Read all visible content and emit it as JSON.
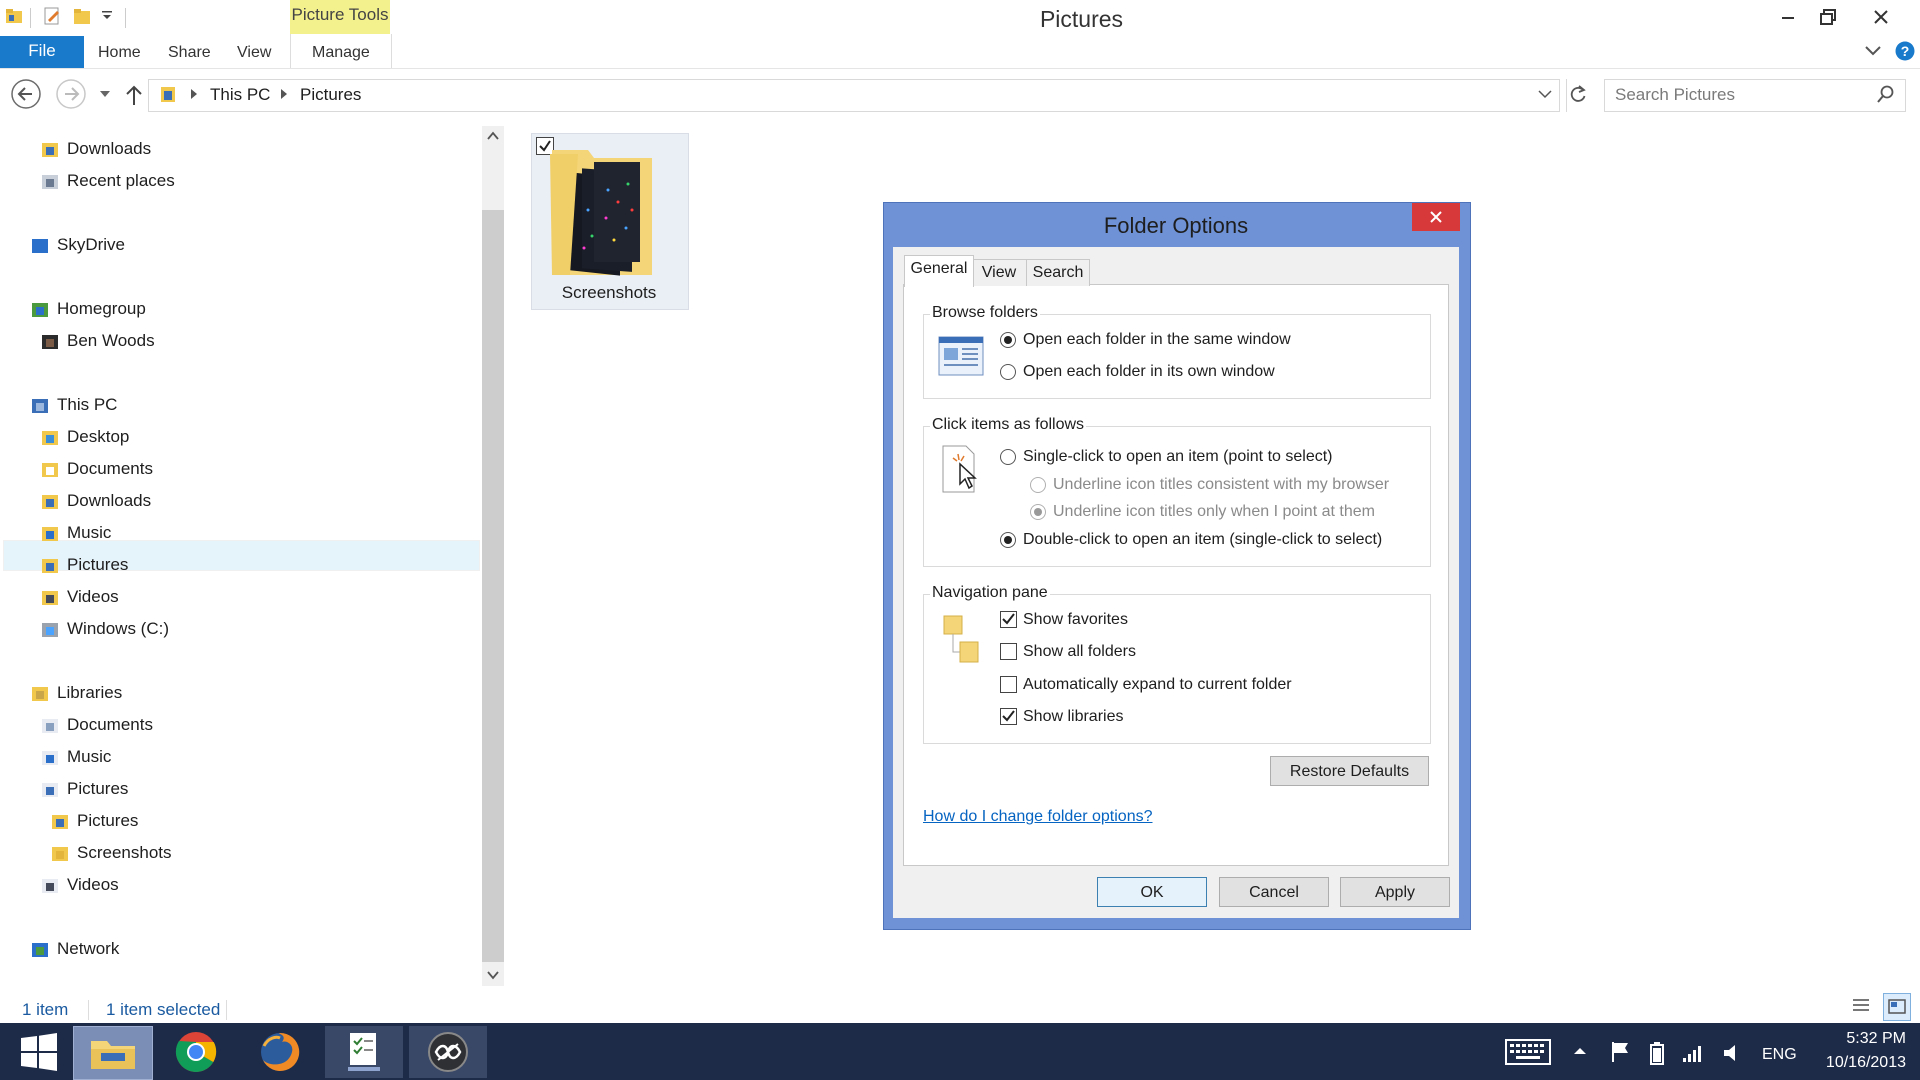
{
  "window": {
    "title": "Pictures",
    "context_tab": "Picture Tools"
  },
  "ribbon": {
    "file": "File",
    "tabs": [
      "Home",
      "Share",
      "View",
      "Manage"
    ]
  },
  "address": {
    "parts": [
      "This PC",
      "Pictures"
    ]
  },
  "search": {
    "placeholder": "Search Pictures"
  },
  "nav": {
    "items": [
      {
        "label": "Downloads",
        "icon": "downloads-folder-icon"
      },
      {
        "label": "Recent places",
        "icon": "recent-places-icon"
      },
      {
        "label": "SkyDrive",
        "icon": "skydrive-cloud-icon"
      },
      {
        "label": "Homegroup",
        "icon": "homegroup-icon"
      },
      {
        "label": "Ben Woods",
        "icon": "user-avatar-icon"
      },
      {
        "label": "This PC",
        "icon": "this-pc-icon"
      },
      {
        "label": "Desktop",
        "icon": "desktop-folder-icon"
      },
      {
        "label": "Documents",
        "icon": "documents-folder-icon"
      },
      {
        "label": "Downloads",
        "icon": "downloads-folder-icon"
      },
      {
        "label": "Music",
        "icon": "music-folder-icon"
      },
      {
        "label": "Pictures",
        "icon": "pictures-folder-icon"
      },
      {
        "label": "Videos",
        "icon": "videos-folder-icon"
      },
      {
        "label": "Windows (C:)",
        "icon": "drive-icon"
      },
      {
        "label": "Libraries",
        "icon": "libraries-icon"
      },
      {
        "label": "Documents",
        "icon": "documents-library-icon"
      },
      {
        "label": "Music",
        "icon": "music-library-icon"
      },
      {
        "label": "Pictures",
        "icon": "pictures-library-icon"
      },
      {
        "label": "Pictures",
        "icon": "pictures-folder-icon"
      },
      {
        "label": "Screenshots",
        "icon": "folder-icon"
      },
      {
        "label": "Videos",
        "icon": "videos-library-icon"
      },
      {
        "label": "Network",
        "icon": "network-icon"
      }
    ],
    "selected": "Pictures"
  },
  "content": {
    "folder_name": "Screenshots"
  },
  "status": {
    "count": "1 item",
    "selected": "1 item selected"
  },
  "dialog": {
    "title": "Folder Options",
    "tabs": [
      "General",
      "View",
      "Search"
    ],
    "browse": {
      "label": "Browse folders",
      "options": [
        "Open each folder in the same window",
        "Open each folder in its own window"
      ],
      "selected": 0
    },
    "click": {
      "label": "Click items as follows",
      "single": "Single-click to open an item (point to select)",
      "underline_browser": "Underline icon titles consistent with my browser",
      "underline_point": "Underline icon titles only when I point at them",
      "double": "Double-click to open an item (single-click to select)"
    },
    "navpane": {
      "label": "Navigation pane",
      "options": [
        {
          "label": "Show favorites",
          "checked": true
        },
        {
          "label": "Show all folders",
          "checked": false
        },
        {
          "label": "Automatically expand to current folder",
          "checked": false
        },
        {
          "label": "Show libraries",
          "checked": true
        }
      ]
    },
    "restore": "Restore Defaults",
    "help": "How do I change folder options?",
    "ok": "OK",
    "cancel": "Cancel",
    "apply": "Apply"
  },
  "taskbar": {
    "apps": [
      "start-icon",
      "file-explorer-icon",
      "chrome-icon",
      "firefox-icon",
      "tasks-app-icon",
      "app-icon"
    ],
    "lang": "ENG",
    "time": "5:32 PM",
    "date": "10/16/2013"
  },
  "colors": {
    "accent": "#1979ca",
    "dialog_frame": "#6f92d6",
    "close": "#d7383a",
    "taskbar": "#1e2b48",
    "context_tab": "#f3f08e"
  }
}
